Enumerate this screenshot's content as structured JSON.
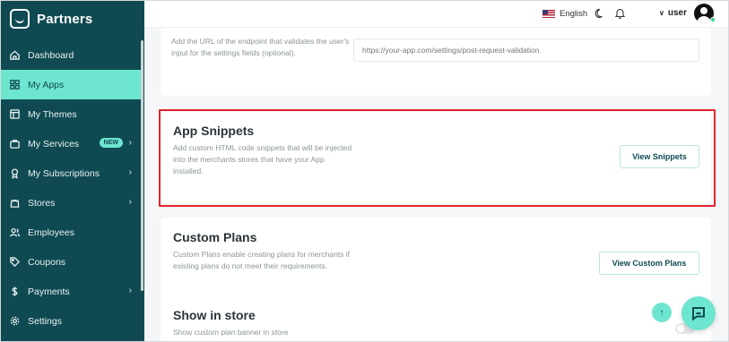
{
  "brand": {
    "name": "Partners"
  },
  "sidebar": {
    "items": [
      {
        "label": "Dashboard",
        "icon": "home-icon"
      },
      {
        "label": "My Apps",
        "icon": "apps-grid-icon",
        "active": true
      },
      {
        "label": "My Themes",
        "icon": "themes-icon"
      },
      {
        "label": "My Services",
        "icon": "services-icon",
        "badge": "NEW",
        "chevron": true
      },
      {
        "label": "My Subscriptions",
        "icon": "subscriptions-icon",
        "chevron": true
      },
      {
        "label": "Stores",
        "icon": "store-icon",
        "chevron": true
      },
      {
        "label": "Employees",
        "icon": "employees-icon"
      },
      {
        "label": "Coupons",
        "icon": "coupon-icon"
      },
      {
        "label": "Payments",
        "icon": "dollar-icon",
        "chevron": true
      },
      {
        "label": "Settings",
        "icon": "gear-icon"
      }
    ]
  },
  "topbar": {
    "language": "English",
    "user": "user"
  },
  "validation": {
    "description": "Add the URL of the endpoint that validates the user's input for the settings fields (optional).",
    "url_placeholder": "https://your-app.com/settings/post-request-validation"
  },
  "snippets": {
    "title": "App Snippets",
    "description": "Add custom HTML code snippets that will be injected into the merchants stores that have your App installed.",
    "button": "View Snippets"
  },
  "custom_plans": {
    "title": "Custom Plans",
    "description": "Custom Plans enable creating plans for merchants if existing plans do not meet their requirements.",
    "button": "View Custom Plans"
  },
  "show_in_store": {
    "title": "Show in store",
    "description": "Show custom plan banner in store",
    "enabled": false
  },
  "colors": {
    "sidebar_bg": "#0f4a52",
    "accent": "#6ee5cf",
    "highlight_border": "#e0262c"
  }
}
